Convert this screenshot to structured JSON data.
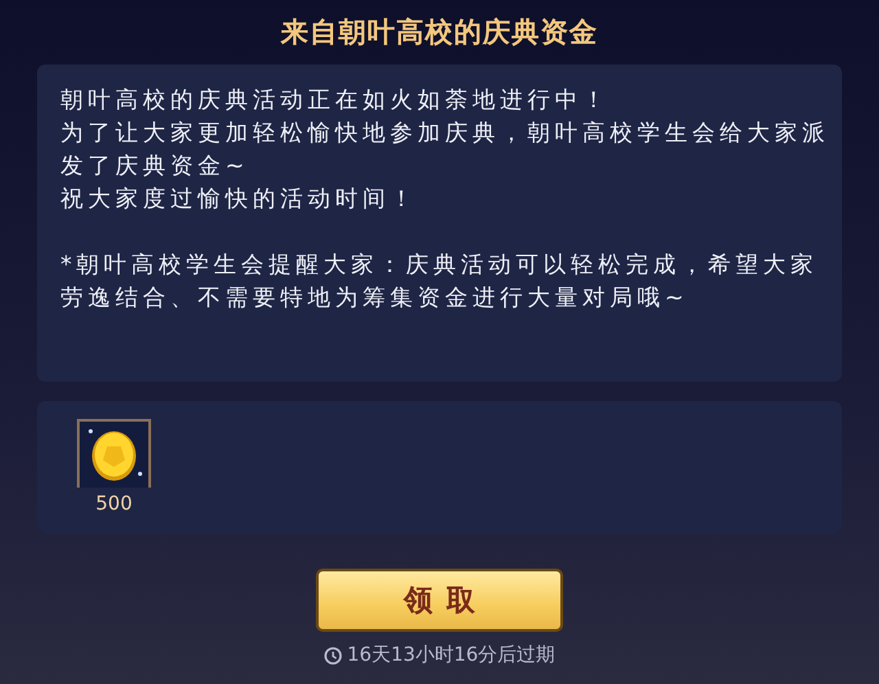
{
  "title": "来自朝叶高校的庆典资金",
  "message": {
    "paragraphs": [
      "朝叶高校的庆典活动正在如火如荼地进行中！",
      "为了让大家更加轻松愉快地参加庆典，朝叶高校学生会给大家派发了庆典资金~",
      "祝大家度过愉快的活动时间！"
    ],
    "note": "*朝叶高校学生会提醒大家：庆典活动可以轻松完成，希望大家劳逸结合、不需要特地为筹集资金进行大量对局哦~"
  },
  "rewards": [
    {
      "kind": "coin",
      "amount": "500"
    }
  ],
  "claim_button": {
    "label": "领取"
  },
  "expiry": "16天13小时16分后过期"
}
